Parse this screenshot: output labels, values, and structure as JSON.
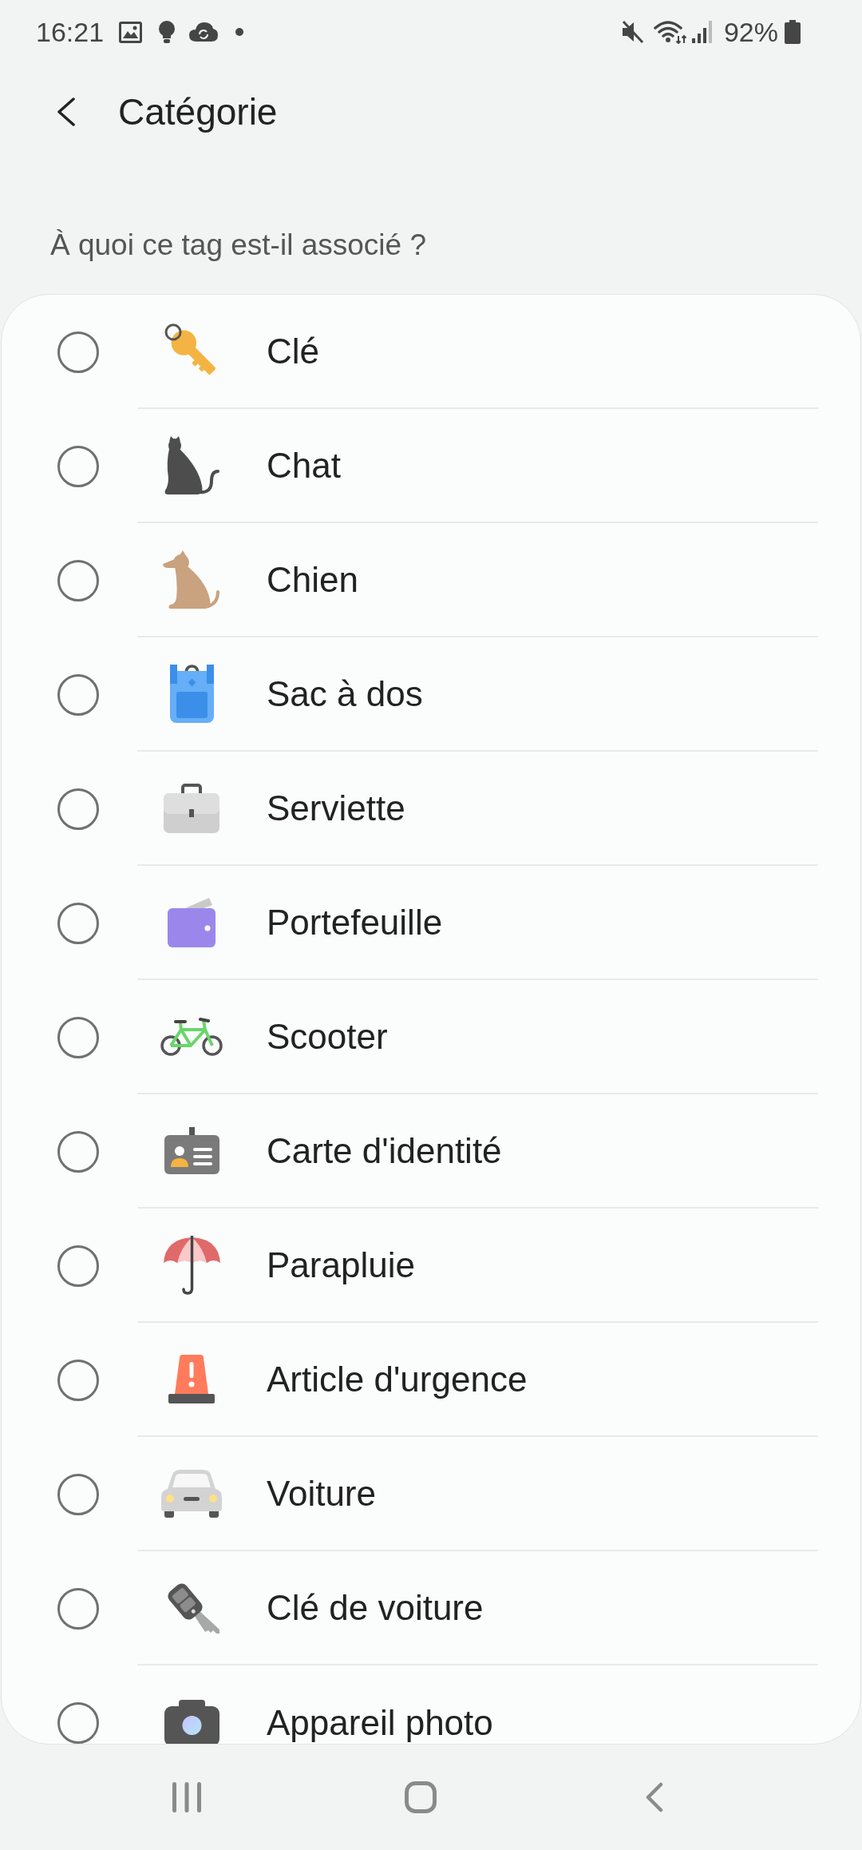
{
  "status_bar": {
    "time": "16:21",
    "battery": "92%"
  },
  "header": {
    "title": "Catégorie"
  },
  "prompt": "À quoi ce tag est-il associé ?",
  "categories": [
    {
      "label": "Clé",
      "kind": "key",
      "selected": false
    },
    {
      "label": "Chat",
      "kind": "cat",
      "selected": false
    },
    {
      "label": "Chien",
      "kind": "dog",
      "selected": false
    },
    {
      "label": "Sac à dos",
      "kind": "backpack",
      "selected": false
    },
    {
      "label": "Serviette",
      "kind": "briefcase",
      "selected": false
    },
    {
      "label": "Portefeuille",
      "kind": "wallet",
      "selected": false
    },
    {
      "label": "Scooter",
      "kind": "bicycle",
      "selected": false
    },
    {
      "label": "Carte d'identité",
      "kind": "idcard",
      "selected": false
    },
    {
      "label": "Parapluie",
      "kind": "umbrella",
      "selected": false
    },
    {
      "label": "Article d'urgence",
      "kind": "beacon",
      "selected": false
    },
    {
      "label": "Voiture",
      "kind": "car",
      "selected": false
    },
    {
      "label": "Clé de voiture",
      "kind": "carkey",
      "selected": false
    },
    {
      "label": "Appareil photo",
      "kind": "camera",
      "selected": false
    }
  ]
}
